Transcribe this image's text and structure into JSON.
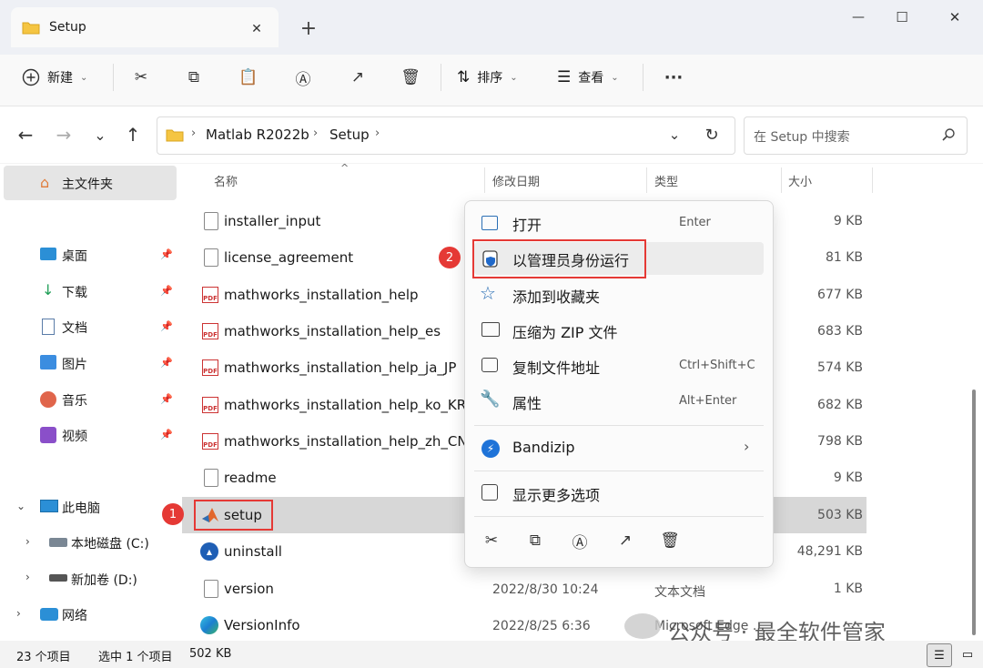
{
  "window": {
    "tab_title": "Setup",
    "new_tab": "+",
    "controls": {
      "minimize": "—",
      "maximize": "☐",
      "close": "✕"
    }
  },
  "toolbar": {
    "new_label": "新建",
    "sort_label": "排序",
    "view_label": "查看",
    "more_label": "···"
  },
  "address": {
    "crumbs": [
      "Matlab R2022b",
      "Setup"
    ],
    "separator": "›",
    "search_placeholder": "在 Setup 中搜索"
  },
  "nav": {
    "home": "主文件夹",
    "quick": [
      {
        "label": "桌面",
        "icon": "desktop-icon"
      },
      {
        "label": "下载",
        "icon": "download-icon"
      },
      {
        "label": "文档",
        "icon": "document-icon"
      },
      {
        "label": "图片",
        "icon": "pictures-icon"
      },
      {
        "label": "音乐",
        "icon": "music-icon"
      },
      {
        "label": "视频",
        "icon": "video-icon"
      }
    ],
    "this_pc": "此电脑",
    "drive_c": "本地磁盘 (C:)",
    "drive_d": "新加卷 (D:)",
    "network": "网络"
  },
  "columns": {
    "name": "名称",
    "modified": "修改日期",
    "type": "类型",
    "size": "大小"
  },
  "files": [
    {
      "name": "installer_input",
      "icon": "text",
      "date": "",
      "type": "",
      "size": "9 KB"
    },
    {
      "name": "license_agreement",
      "icon": "text",
      "date": "",
      "type": "",
      "size": "81 KB"
    },
    {
      "name": "mathworks_installation_help",
      "icon": "pdf",
      "date": "",
      "type": "",
      "size": "677 KB"
    },
    {
      "name": "mathworks_installation_help_es",
      "icon": "pdf",
      "date": "",
      "type": "",
      "size": "683 KB"
    },
    {
      "name": "mathworks_installation_help_ja_JP",
      "icon": "pdf",
      "date": "",
      "type": "",
      "size": "574 KB"
    },
    {
      "name": "mathworks_installation_help_ko_KR",
      "icon": "pdf",
      "date": "",
      "type": "",
      "size": "682 KB"
    },
    {
      "name": "mathworks_installation_help_zh_CN",
      "icon": "pdf",
      "date": "",
      "type": "",
      "size": "798 KB"
    },
    {
      "name": "readme",
      "icon": "text",
      "date": "",
      "type": "",
      "size": "9 KB"
    },
    {
      "name": "setup",
      "icon": "matlab",
      "date": "",
      "type": "",
      "size": "503 KB"
    },
    {
      "name": "uninstall",
      "icon": "zip",
      "date": "",
      "type": "",
      "size": "48,291 KB"
    },
    {
      "name": "version",
      "icon": "text",
      "date": "2022/8/30 10:24",
      "type": "文本文档",
      "size": "1 KB"
    },
    {
      "name": "VersionInfo",
      "icon": "edge",
      "date": "2022/8/25 6:36",
      "type": "Microsoft Edge ...",
      "size": ""
    }
  ],
  "context_menu": {
    "open": "打开",
    "open_shortcut": "Enter",
    "run_as_admin": "以管理员身份运行",
    "add_favorite": "添加到收藏夹",
    "compress_zip": "压缩为 ZIP 文件",
    "copy_path": "复制文件地址",
    "copy_path_shortcut": "Ctrl+Shift+C",
    "properties": "属性",
    "properties_shortcut": "Alt+Enter",
    "bandizip": "Bandizip",
    "more_options": "显示更多选项"
  },
  "annotations": {
    "badge1": "1",
    "badge2": "2"
  },
  "status": {
    "count": "23 个项目",
    "selected": "选中 1 个项目",
    "size": "502 KB"
  },
  "watermark": "公众号 · 最全软件管家",
  "colors": {
    "accent": "#005fb8",
    "highlight": "#e53935",
    "folder": "#f5c542"
  }
}
